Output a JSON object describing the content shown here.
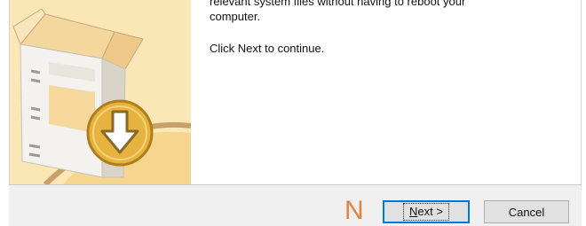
{
  "body": {
    "cut_line": "relevant system files without having to reboot your",
    "line2": "computer.",
    "para2": "Click Next to continue."
  },
  "annotation": "N",
  "buttons": {
    "next_mnemonic": "N",
    "next_rest": "ext >",
    "cancel": "Cancel"
  },
  "colors": {
    "banner_bg": "#fbe7b5",
    "footer_bg": "#f0f0f0",
    "focus_border": "#0078d7",
    "annotation": "#e8813a"
  },
  "icons": {
    "banner": "installer-box-download-icon"
  }
}
